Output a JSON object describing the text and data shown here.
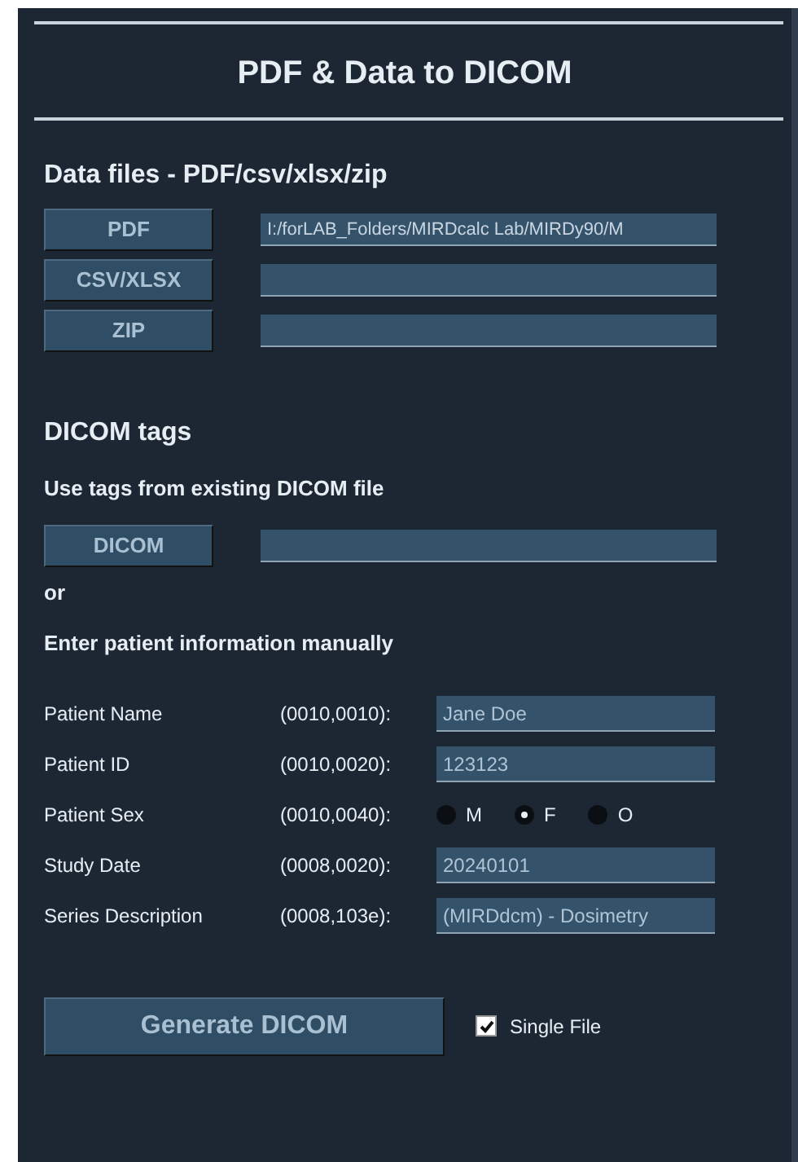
{
  "title": "PDF & Data to DICOM",
  "data_files": {
    "heading": "Data files - PDF/csv/xlsx/zip",
    "rows": [
      {
        "button": "PDF",
        "value": "I:/forLAB_Folders/MIRDcalc Lab/MIRDy90/M"
      },
      {
        "button": "CSV/XLSX"
      },
      {
        "button": "ZIP"
      }
    ]
  },
  "dicom_tags": {
    "heading": "DICOM tags",
    "subheading": "Use tags from existing DICOM file",
    "button": "DICOM",
    "or": "or",
    "manual_heading": "Enter patient information manually"
  },
  "patient_fields": [
    {
      "kind": "text",
      "label": "Patient Name",
      "tag": "(0010,0010):",
      "value": "Jane Doe"
    },
    {
      "kind": "text",
      "label": "Patient ID",
      "tag": "(0010,0020):",
      "value": "123123"
    },
    {
      "kind": "radio",
      "label": "Patient Sex",
      "tag": "(0010,0040):",
      "options": [
        {
          "label": "M",
          "selected": false
        },
        {
          "label": "F",
          "selected": true
        },
        {
          "label": "O",
          "selected": false
        }
      ]
    },
    {
      "kind": "text",
      "label": "Study Date",
      "tag": "(0008,0020):",
      "value": "20240101"
    },
    {
      "kind": "text",
      "label": "Series Description",
      "tag": "(0008,103e):",
      "value": "(MIRDdcm) - Dosimetry"
    }
  ],
  "generate_button": "Generate DICOM",
  "single_file": {
    "label": "Single File",
    "checked": true
  }
}
